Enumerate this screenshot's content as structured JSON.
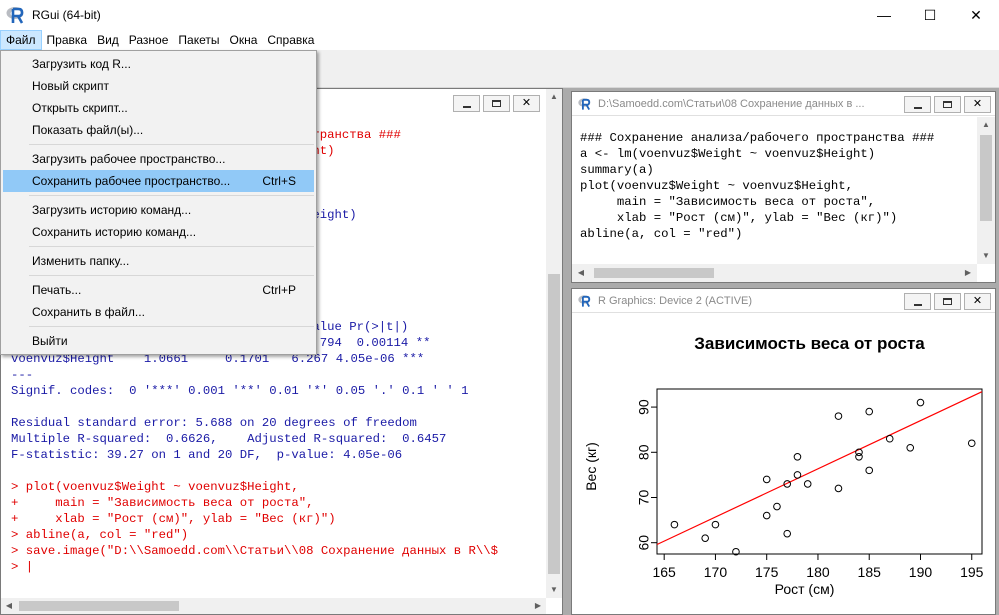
{
  "window": {
    "title": "RGui (64-bit)",
    "ctrl_min": "—",
    "ctrl_max": "☐",
    "ctrl_close": "✕"
  },
  "menubar": [
    "Файл",
    "Правка",
    "Вид",
    "Разное",
    "Пакеты",
    "Окна",
    "Справка"
  ],
  "file_menu": {
    "items": [
      {
        "label": "Загрузить код R...",
        "shortcut": ""
      },
      {
        "label": "Новый скрипт",
        "shortcut": ""
      },
      {
        "label": "Открыть скрипт...",
        "shortcut": ""
      },
      {
        "label": "Показать файл(ы)...",
        "shortcut": ""
      },
      {
        "label": "Загрузить рабочее пространство...",
        "shortcut": ""
      },
      {
        "label": "Сохранить рабочее пространство...",
        "shortcut": "Ctrl+S"
      },
      {
        "label": "Загрузить историю команд...",
        "shortcut": ""
      },
      {
        "label": "Сохранить историю команд...",
        "shortcut": ""
      },
      {
        "label": "Изменить папку...",
        "shortcut": ""
      },
      {
        "label": "Печать...",
        "shortcut": "Ctrl+P"
      },
      {
        "label": "Сохранить в файл...",
        "shortcut": ""
      },
      {
        "label": "Выйти",
        "shortcut": ""
      }
    ],
    "highlighted_index": 5
  },
  "console": {
    "lines_top": [
      {
        "text": "странства ###",
        "color": "red"
      },
      {
        "text": "ght)",
        "color": "red"
      },
      {
        "text": "",
        "color": "blue"
      },
      {
        "text": "",
        "color": "blue"
      },
      {
        "text": "",
        "color": "blue"
      },
      {
        "text": "Height)",
        "color": "blue"
      },
      {
        "text": "",
        "color": "blue"
      },
      {
        "text": "",
        "color": "blue"
      },
      {
        "text": "x",
        "color": "blue"
      },
      {
        "text": "1",
        "color": "blue"
      },
      {
        "text": "",
        "color": "blue"
      },
      {
        "text": "",
        "color": "blue"
      },
      {
        "text": "value Pr(>|t|)",
        "color": "blue"
      },
      {
        "text": "3.794  0.00114 **",
        "color": "blue"
      }
    ],
    "lines": [
      {
        "text": "voenvuz$Height    1.0661     0.1701   6.267 4.05e-06 ***",
        "color": "blue"
      },
      {
        "text": "---",
        "color": "blue"
      },
      {
        "text": "Signif. codes:  0 '***' 0.001 '**' 0.01 '*' 0.05 '.' 0.1 ' ' 1",
        "color": "blue"
      },
      {
        "text": "",
        "color": "blue"
      },
      {
        "text": "Residual standard error: 5.688 on 20 degrees of freedom",
        "color": "blue"
      },
      {
        "text": "Multiple R-squared:  0.6626,    Adjusted R-squared:  0.6457",
        "color": "blue"
      },
      {
        "text": "F-statistic: 39.27 on 1 and 20 DF,  p-value: 4.05e-06",
        "color": "blue"
      },
      {
        "text": "",
        "color": "blue"
      },
      {
        "text": "> plot(voenvuz$Weight ~ voenvuz$Height,",
        "color": "red"
      },
      {
        "text": "+     main = \"Зависимость веса от роста\",",
        "color": "red"
      },
      {
        "text": "+     xlab = \"Рост (см)\", ylab = \"Вес (кг)\")",
        "color": "red"
      },
      {
        "text": "> abline(a, col = \"red\")",
        "color": "red"
      },
      {
        "text": "> save.image(\"D:\\\\Samoedd.com\\\\Статьи\\\\08 Сохранение данных в R\\\\$",
        "color": "red"
      },
      {
        "text": "> |",
        "color": "red"
      }
    ]
  },
  "script_window": {
    "title": "D:\\Samoedd.com\\Статьи\\08 Сохранение данных в ...",
    "lines": [
      "### Сохранение анализа/рабочего пространства ###",
      "a <- lm(voenvuz$Weight ~ voenvuz$Height)",
      "summary(a)",
      "plot(voenvuz$Weight ~ voenvuz$Height,",
      "     main = \"Зависимость веса от роста\",",
      "     xlab = \"Рост (см)\", ylab = \"Вес (кг)\")",
      "abline(a, col = \"red\")"
    ]
  },
  "graphics_window": {
    "title": "R Graphics: Device 2 (ACTIVE)"
  },
  "chart_data": {
    "type": "scatter",
    "title": "Зависимость веса от роста",
    "xlabel": "Рост (см)",
    "ylabel": "Вес (кг)",
    "xlim": [
      164.3,
      196.0
    ],
    "ylim": [
      57.5,
      94.0
    ],
    "xticks": [
      165,
      170,
      175,
      180,
      185,
      190,
      195
    ],
    "yticks": [
      60,
      70,
      80,
      90
    ],
    "points": [
      [
        166,
        64
      ],
      [
        169,
        61
      ],
      [
        170,
        64
      ],
      [
        172,
        58
      ],
      [
        175,
        66
      ],
      [
        175,
        74
      ],
      [
        176,
        68
      ],
      [
        177,
        62
      ],
      [
        177,
        73
      ],
      [
        178,
        75
      ],
      [
        178,
        79
      ],
      [
        179,
        73
      ],
      [
        182,
        72
      ],
      [
        182,
        88
      ],
      [
        184,
        79
      ],
      [
        184,
        80
      ],
      [
        185,
        76
      ],
      [
        185,
        89
      ],
      [
        187,
        83
      ],
      [
        189,
        81
      ],
      [
        190,
        91
      ],
      [
        195,
        82
      ]
    ],
    "regression": {
      "color": "#ff0000",
      "x": [
        164.3,
        196.0
      ],
      "y": [
        59.6,
        93.4
      ]
    },
    "grid": false,
    "legend": "none"
  }
}
